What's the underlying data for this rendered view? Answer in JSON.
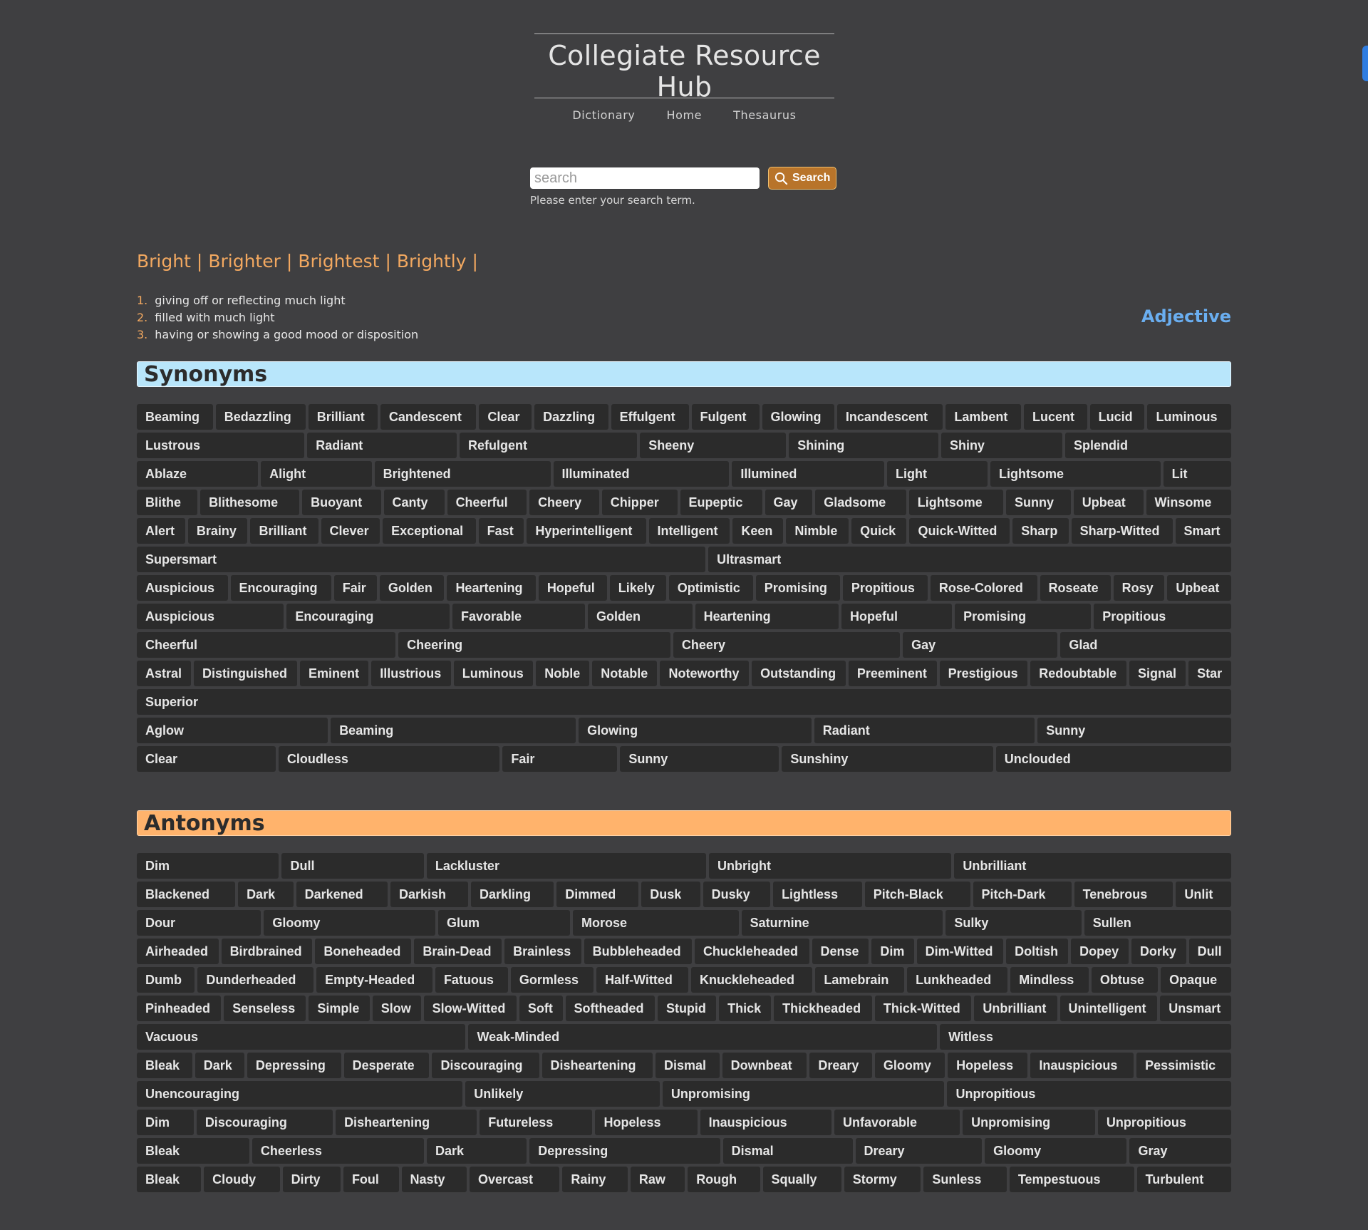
{
  "site": {
    "title": "Collegiate Resource Hub",
    "nav": [
      "Dictionary",
      "Home",
      "Thesaurus"
    ]
  },
  "search": {
    "placeholder": "search",
    "button_label": "Search",
    "hint": "Please enter your search term."
  },
  "word_forms": [
    "Bright",
    "Brighter",
    "Brightest",
    "Brightly"
  ],
  "definitions": [
    "giving off or reflecting much light",
    "filled with much light",
    "having or showing a good mood or disposition"
  ],
  "part_of_speech": "Adjective",
  "synonyms": {
    "heading": "Synonyms",
    "rows": [
      [
        "Beaming",
        "Bedazzling",
        "Brilliant",
        "Candescent",
        "Clear",
        "Dazzling",
        "Effulgent",
        "Fulgent",
        "Glowing",
        "Incandescent",
        "Lambent",
        "Lucent",
        "Lucid",
        "Luminous"
      ],
      [
        "Lustrous",
        "Radiant",
        "Refulgent",
        "Sheeny",
        "Shining",
        "Shiny",
        "Splendid"
      ],
      [
        "Ablaze",
        "Alight",
        "Brightened",
        "Illuminated",
        "Illumined",
        "Light",
        "Lightsome",
        "Lit"
      ],
      [
        "Blithe",
        "Blithesome",
        "Buoyant",
        "Canty",
        "Cheerful",
        "Cheery",
        "Chipper",
        "Eupeptic",
        "Gay",
        "Gladsome",
        "Lightsome",
        "Sunny",
        "Upbeat",
        "Winsome"
      ],
      [
        "Alert",
        "Brainy",
        "Brilliant",
        "Clever",
        "Exceptional",
        "Fast",
        "Hyperintelligent",
        "Intelligent",
        "Keen",
        "Nimble",
        "Quick",
        "Quick-Witted",
        "Sharp",
        "Sharp-Witted",
        "Smart"
      ],
      [
        "Supersmart",
        "Ultrasmart"
      ],
      [
        "Auspicious",
        "Encouraging",
        "Fair",
        "Golden",
        "Heartening",
        "Hopeful",
        "Likely",
        "Optimistic",
        "Promising",
        "Propitious",
        "Rose-Colored",
        "Roseate",
        "Rosy",
        "Upbeat"
      ],
      [
        "Auspicious",
        "Encouraging",
        "Favorable",
        "Golden",
        "Heartening",
        "Hopeful",
        "Promising",
        "Propitious"
      ],
      [
        "Cheerful",
        "Cheering",
        "Cheery",
        "Gay",
        "Glad"
      ],
      [
        "Astral",
        "Distinguished",
        "Eminent",
        "Illustrious",
        "Luminous",
        "Noble",
        "Notable",
        "Noteworthy",
        "Outstanding",
        "Preeminent",
        "Prestigious",
        "Redoubtable",
        "Signal",
        "Star"
      ],
      [
        "Superior"
      ],
      [
        "Aglow",
        "Beaming",
        "Glowing",
        "Radiant",
        "Sunny"
      ],
      [
        "Clear",
        "Cloudless",
        "Fair",
        "Sunny",
        "Sunshiny",
        "Unclouded"
      ]
    ]
  },
  "antonyms": {
    "heading": "Antonyms",
    "rows": [
      [
        "Dim",
        "Dull",
        "Lackluster",
        "Unbright",
        "Unbrilliant"
      ],
      [
        "Blackened",
        "Dark",
        "Darkened",
        "Darkish",
        "Darkling",
        "Dimmed",
        "Dusk",
        "Dusky",
        "Lightless",
        "Pitch-Black",
        "Pitch-Dark",
        "Tenebrous",
        "Unlit"
      ],
      [
        "Dour",
        "Gloomy",
        "Glum",
        "Morose",
        "Saturnine",
        "Sulky",
        "Sullen"
      ],
      [
        "Airheaded",
        "Birdbrained",
        "Boneheaded",
        "Brain-Dead",
        "Brainless",
        "Bubbleheaded",
        "Chuckleheaded",
        "Dense",
        "Dim",
        "Dim-Witted",
        "Doltish",
        "Dopey",
        "Dorky",
        "Dull"
      ],
      [
        "Dumb",
        "Dunderheaded",
        "Empty-Headed",
        "Fatuous",
        "Gormless",
        "Half-Witted",
        "Knuckleheaded",
        "Lamebrain",
        "Lunkheaded",
        "Mindless",
        "Obtuse",
        "Opaque"
      ],
      [
        "Pinheaded",
        "Senseless",
        "Simple",
        "Slow",
        "Slow-Witted",
        "Soft",
        "Softheaded",
        "Stupid",
        "Thick",
        "Thickheaded",
        "Thick-Witted",
        "Unbrilliant",
        "Unintelligent",
        "Unsmart"
      ],
      [
        "Vacuous",
        "Weak-Minded",
        "Witless"
      ],
      [
        "Bleak",
        "Dark",
        "Depressing",
        "Desperate",
        "Discouraging",
        "Disheartening",
        "Dismal",
        "Downbeat",
        "Dreary",
        "Gloomy",
        "Hopeless",
        "Inauspicious",
        "Pessimistic"
      ],
      [
        "Unencouraging",
        "Unlikely",
        "Unpromising",
        "Unpropitious"
      ],
      [
        "Dim",
        "Discouraging",
        "Disheartening",
        "Futureless",
        "Hopeless",
        "Inauspicious",
        "Unfavorable",
        "Unpromising",
        "Unpropitious"
      ],
      [
        "Bleak",
        "Cheerless",
        "Dark",
        "Depressing",
        "Dismal",
        "Dreary",
        "Gloomy",
        "Gray"
      ],
      [
        "Bleak",
        "Cloudy",
        "Dirty",
        "Foul",
        "Nasty",
        "Overcast",
        "Rainy",
        "Raw",
        "Rough",
        "Squally",
        "Stormy",
        "Sunless",
        "Tempestuous",
        "Turbulent"
      ]
    ]
  },
  "colors": {
    "background": "#3f3f41",
    "accent": "#f2a860",
    "synonyms_bar": "#b8e6fb",
    "antonyms_bar": "#ffb36c",
    "pos": "#6aaef0",
    "tag_bg": "#2b2b2b",
    "search_btn": "#b8742a"
  }
}
